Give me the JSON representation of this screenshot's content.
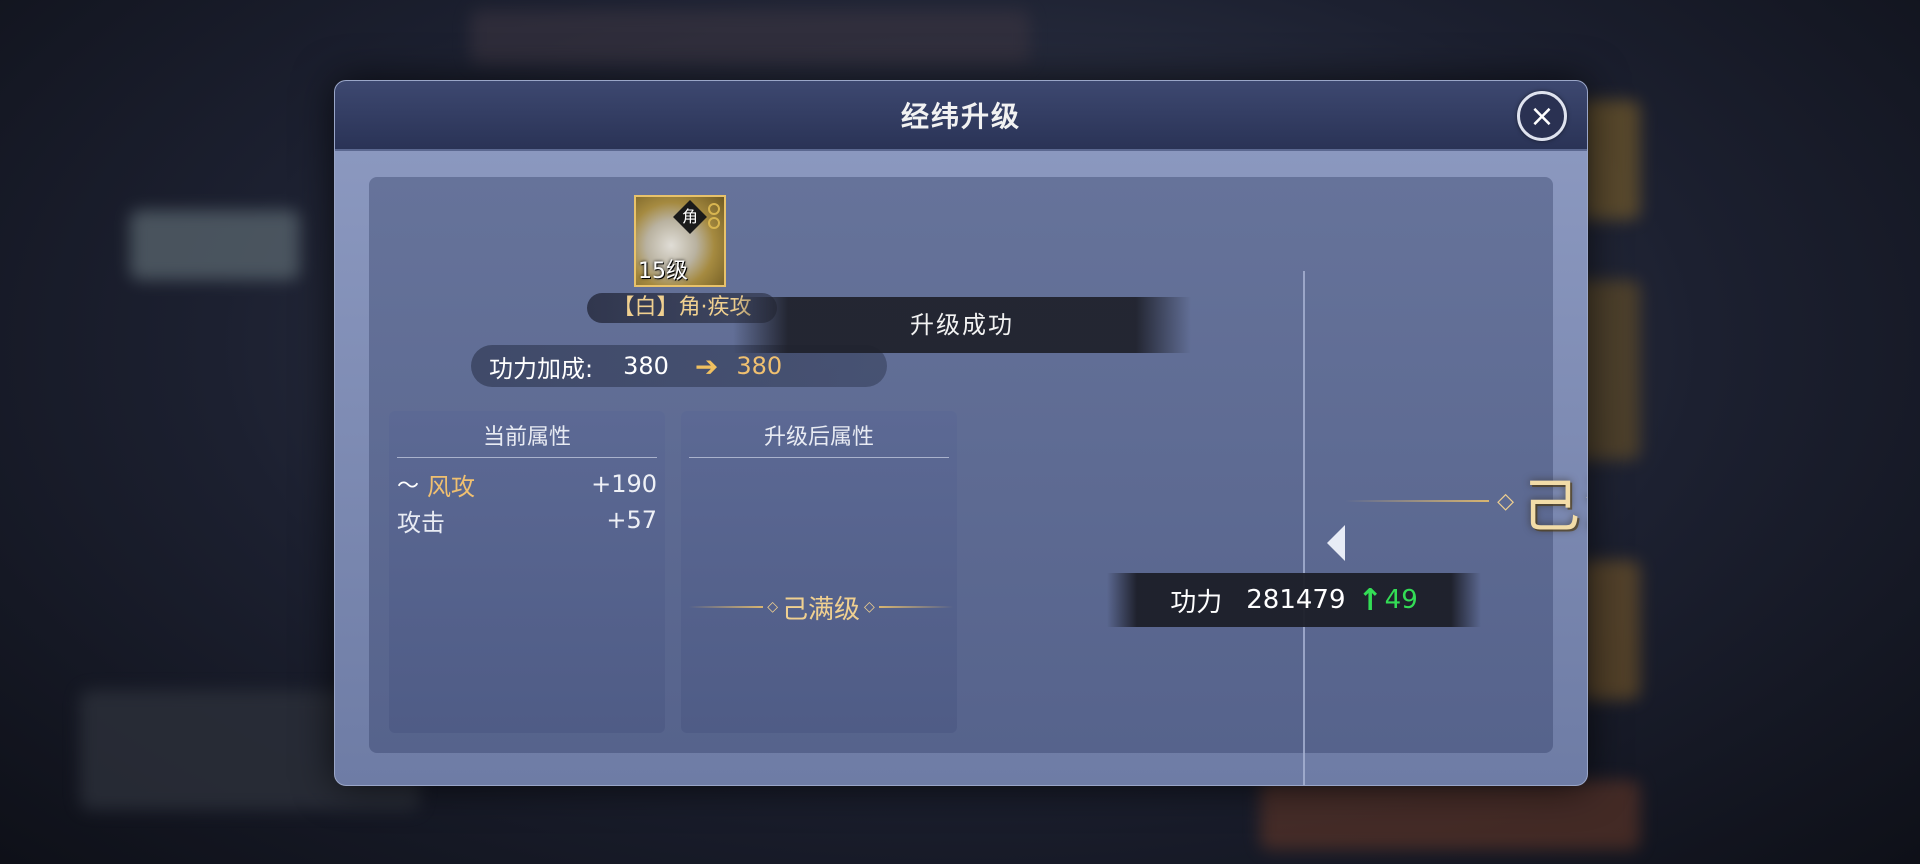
{
  "dialog": {
    "title": "经纬升级",
    "close_icon": "×"
  },
  "item": {
    "char": "角",
    "level": "15级",
    "name": "【白】角·疾攻"
  },
  "banner": {
    "success": "升级成功"
  },
  "power_bonus": {
    "label": "功力加成:",
    "old_value": "380",
    "arrow": "➔",
    "new_value": "380"
  },
  "current_attrs": {
    "title": "当前属性",
    "rows": [
      {
        "name": "风攻",
        "value": "+190",
        "icon": "wind-icon"
      },
      {
        "name": "攻击",
        "value": "+57"
      }
    ]
  },
  "upgraded_attrs": {
    "title": "升级后属性",
    "max_text": "己满级"
  },
  "power_popup": {
    "label": "功力",
    "value": "281479",
    "up_arrow": "↑",
    "increase": "49"
  },
  "max_level": {
    "text": "己满级"
  },
  "colors": {
    "accent_gold": "#f0c070",
    "increase_green": "#33dd55",
    "title_bar": "#2a3356"
  }
}
